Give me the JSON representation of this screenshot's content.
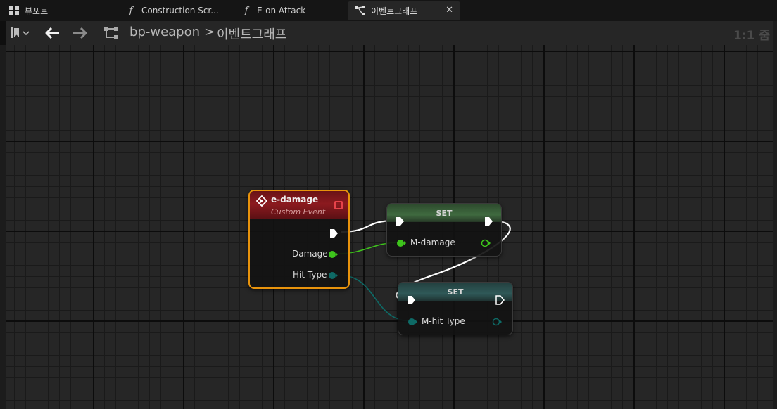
{
  "tabs": [
    {
      "label": "뷰포트",
      "icon": "viewport-grid-icon"
    },
    {
      "label": "Construction Scr...",
      "icon": "function-icon"
    },
    {
      "label": "E-on Attack",
      "icon": "function-icon"
    },
    {
      "label": "이벤트그래프",
      "icon": "event-graph-icon",
      "active": true
    }
  ],
  "toolbar": {
    "breadcrumb_root": "bp-weapon",
    "breadcrumb_separator": ">",
    "breadcrumb_leaf": "이벤트그래프",
    "zoom": "1:1 줌"
  },
  "nodes": {
    "event": {
      "title": "e-damage",
      "subtitle": "Custom Event",
      "outputs": [
        "Damage",
        "Hit Type"
      ]
    },
    "set_damage": {
      "title": "SET",
      "variable": "M-damage"
    },
    "set_hit_type": {
      "title": "SET",
      "variable": "M-hit Type"
    }
  },
  "colors": {
    "event_border": "#e8930c",
    "event_header": "#8c1a1f",
    "float_pin": "#3ec41c",
    "enum_pin": "#0e6a66",
    "exec_wire": "#ffffff"
  }
}
